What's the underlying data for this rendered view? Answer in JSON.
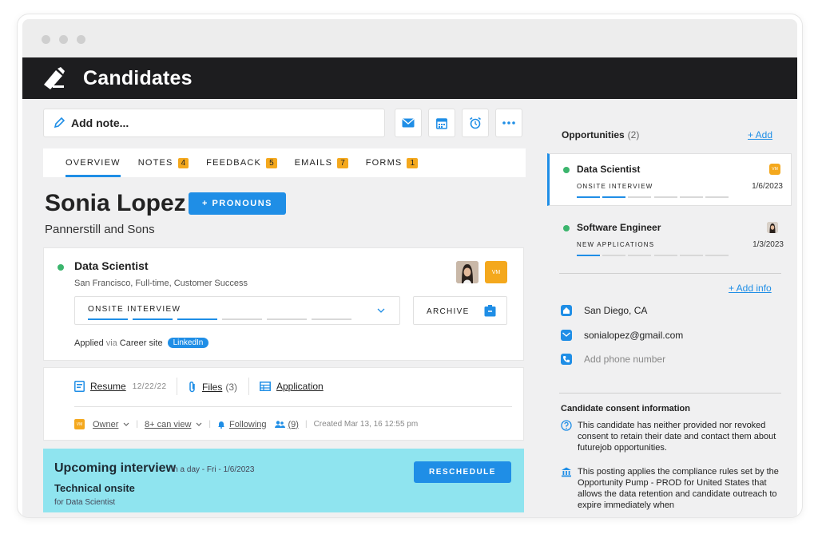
{
  "app": {
    "title": "Candidates"
  },
  "toolbar": {
    "add_note_label": "Add note...",
    "icons": [
      "mail-icon",
      "calendar-icon",
      "alarm-icon",
      "more-icon"
    ]
  },
  "tabs": [
    {
      "label": "OVERVIEW",
      "badge": ""
    },
    {
      "label": "NOTES",
      "badge": "4"
    },
    {
      "label": "FEEDBACK",
      "badge": "5"
    },
    {
      "label": "EMAILS",
      "badge": "7"
    },
    {
      "label": "FORMS",
      "badge": "1"
    }
  ],
  "candidate": {
    "name": "Sonia Lopez",
    "pronouns_button": "+ PRONOUNS",
    "company": "Pannerstill and Sons"
  },
  "job": {
    "title": "Data Scientist",
    "subtitle": "San Francisco, Full-time, Customer Success",
    "stage": "ONSITE INTERVIEW",
    "archive_label": "ARCHIVE",
    "applied_label": "Applied",
    "via_label": "via",
    "source": "Career site",
    "source_chip": "LinkedIn",
    "owner_initials": "VM"
  },
  "files": {
    "resume_label": "Resume",
    "resume_date": "12/22/22",
    "files_label": "Files",
    "files_count": "(3)",
    "application_label": "Application",
    "owner_label": "Owner",
    "can_view_label": "8+ can view",
    "following_label": "Following",
    "followers_count": "(9)",
    "created": "Created Mar 13, 16 12:55 pm"
  },
  "interview": {
    "heading": "Upcoming interview",
    "when": "in a day - Fri - 1/6/2023",
    "title": "Technical onsite",
    "for": "for Data Scientist",
    "reschedule_label": "RESCHEDULE"
  },
  "opportunities": {
    "heading": "Opportunities",
    "count": "(2)",
    "add_label": "+ Add",
    "items": [
      {
        "title": "Data Scientist",
        "stage": "ONSITE INTERVIEW",
        "date": "1/6/2023",
        "progress": 0.33
      },
      {
        "title": "Software Engineer",
        "stage": "NEW APPLICATIONS",
        "date": "1/3/2023",
        "progress": 0.17
      }
    ]
  },
  "contact": {
    "add_info_label": "+ Add info",
    "location": "San Diego, CA",
    "email": "sonialopez@gmail.com",
    "phone_placeholder": "Add phone number"
  },
  "consent": {
    "heading": "Candidate consent information",
    "text1": "This candidate has neither provided nor revoked consent to retain their date and contact them about futurejob opportunities.",
    "text2": "This posting applies the compliance rules set by the Opportunity Pump - PROD for United States that allows the data retention and candidate outreach to expire immediately when"
  },
  "colors": {
    "accent": "#1f8ee6",
    "badge": "#f4a81d",
    "interview_bg": "#8fe4ef",
    "status_green": "#3bb56d",
    "appbar": "#1d1d1f"
  }
}
